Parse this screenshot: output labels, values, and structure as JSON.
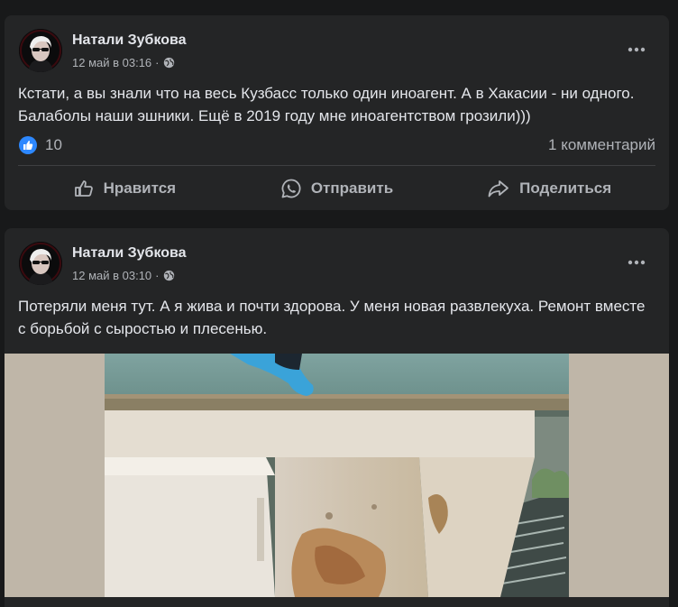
{
  "posts": [
    {
      "author": "Натали Зубкова",
      "timestamp": "12 май в 03:16",
      "text": "Кстати, а вы знали что на весь Кузбасс только один иноагент. А в Хакасии - ни одного. Балаболы наши эшники. Ещё в 2019 году мне иноагентством грозили)))",
      "likes": "10",
      "comments": "1 комментарий",
      "actions": {
        "like": "Нравится",
        "send": "Отправить",
        "share": "Поделиться"
      },
      "colors": {
        "like_badge": "#2d88ff"
      }
    },
    {
      "author": "Натали Зубкова",
      "timestamp": "12 май в 03:10",
      "text": "Потеряли меня тут. А я жива и почти здорова. У меня новая развлекуха. Ремонт вместе с борьбой с сыростью и плесенью."
    }
  ],
  "icons": {
    "privacy": "globe-icon",
    "more": "more-options-icon",
    "like": "thumbs-up-icon",
    "send": "whatsapp-icon",
    "share": "share-arrow-icon"
  }
}
